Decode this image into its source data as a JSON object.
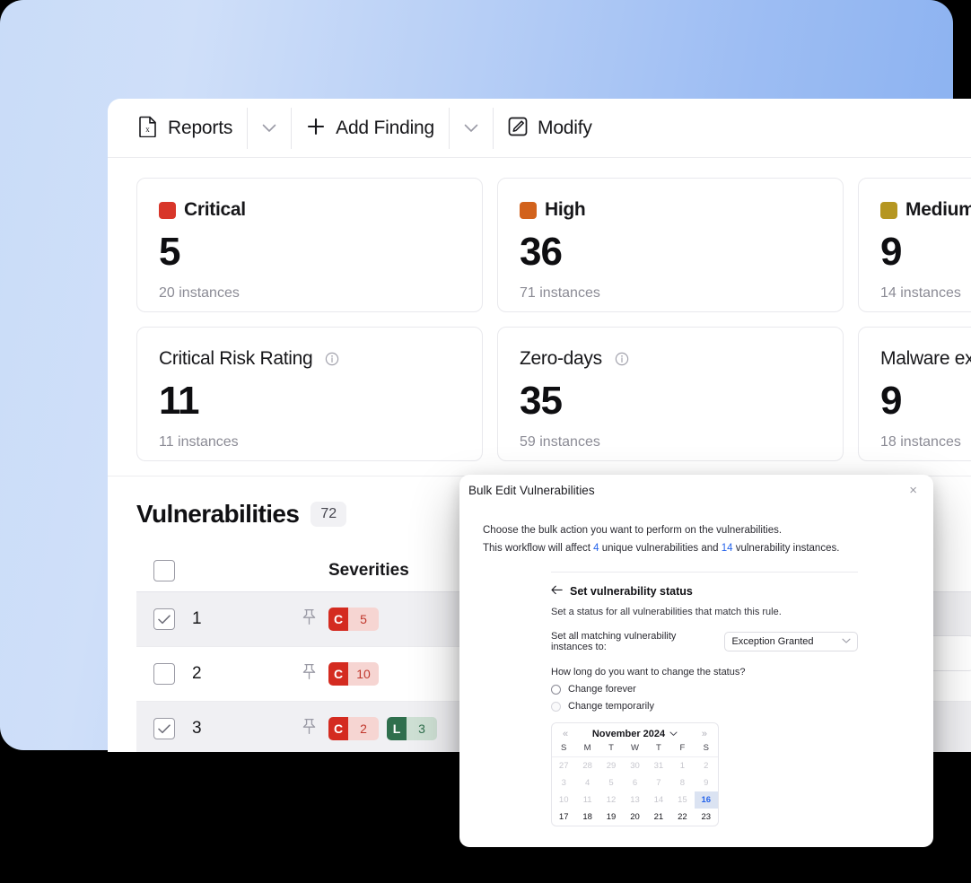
{
  "toolbar": {
    "reports_label": "Reports",
    "add_finding_label": "Add Finding",
    "modify_label": "Modify"
  },
  "stat_cards": [
    {
      "title": "Critical",
      "value": "5",
      "sub": "20 instances",
      "swatch": "#d8362a",
      "has_info": false
    },
    {
      "title": "High",
      "value": "36",
      "sub": "71 instances",
      "swatch": "#d2621c",
      "has_info": false
    },
    {
      "title": "Medium",
      "value": "9",
      "sub": "14 instances",
      "swatch": "#b59621",
      "has_info": false
    },
    {
      "title": "Critical Risk Rating",
      "value": "11",
      "sub": "11 instances",
      "swatch": null,
      "has_info": true
    },
    {
      "title": "Zero-days",
      "value": "35",
      "sub": "59 instances",
      "swatch": null,
      "has_info": true
    },
    {
      "title": "Malware expl",
      "value": "9",
      "sub": "18 instances",
      "swatch": null,
      "has_info": false
    }
  ],
  "vulnerabilities": {
    "title": "Vulnerabilities",
    "count": "72",
    "columns": {
      "severities": "Severities"
    },
    "rows": [
      {
        "num": "1",
        "checked": true,
        "badges": [
          {
            "kind": "crit",
            "key": "C",
            "value": "5"
          }
        ]
      },
      {
        "num": "2",
        "checked": false,
        "badges": [
          {
            "kind": "crit",
            "key": "C",
            "value": "10"
          }
        ]
      },
      {
        "num": "3",
        "checked": true,
        "badges": [
          {
            "kind": "crit",
            "key": "C",
            "value": "2"
          },
          {
            "kind": "low",
            "key": "L",
            "value": "3"
          }
        ]
      }
    ]
  },
  "modal": {
    "title": "Bulk Edit Vulnerabilities",
    "close_label": "×",
    "intro_line": "Choose the bulk action you want to perform on the vulnerabilities.",
    "affect_prefix": "This workflow will affect ",
    "affect_unique_count": "4",
    "affect_middle": " unique vulnerabilities and ",
    "affect_instance_count": "14",
    "affect_suffix": " vulnerability instances.",
    "rule": {
      "title": "Set vulnerability status",
      "subtitle": "Set a status for all vulnerabilities that match this rule.",
      "status_label": "Set all matching vulnerability instances to:",
      "status_value": "Exception Granted",
      "duration_question": "How long do you want to change the status?",
      "radio_forever": "Change forever",
      "radio_temporary": "Change temporarily"
    },
    "calendar": {
      "prev_label": "«",
      "next_label": "»",
      "month_label": "November 2024",
      "dow": [
        "S",
        "M",
        "T",
        "W",
        "T",
        "F",
        "S"
      ],
      "weeks": [
        [
          {
            "d": "27",
            "m": true
          },
          {
            "d": "28",
            "m": true
          },
          {
            "d": "29",
            "m": true
          },
          {
            "d": "30",
            "m": true
          },
          {
            "d": "31",
            "m": true
          },
          {
            "d": "1",
            "m": true
          },
          {
            "d": "2",
            "m": true
          }
        ],
        [
          {
            "d": "3",
            "m": true
          },
          {
            "d": "4",
            "m": true
          },
          {
            "d": "5",
            "m": true
          },
          {
            "d": "6",
            "m": true
          },
          {
            "d": "7",
            "m": true
          },
          {
            "d": "8",
            "m": true
          },
          {
            "d": "9",
            "m": true
          }
        ],
        [
          {
            "d": "10",
            "m": true
          },
          {
            "d": "11",
            "m": true
          },
          {
            "d": "12",
            "m": true
          },
          {
            "d": "13",
            "m": true
          },
          {
            "d": "14",
            "m": true
          },
          {
            "d": "15",
            "m": true
          },
          {
            "d": "16",
            "m": false,
            "today": true
          }
        ],
        [
          {
            "d": "17"
          },
          {
            "d": "18"
          },
          {
            "d": "19"
          },
          {
            "d": "20"
          },
          {
            "d": "21"
          },
          {
            "d": "22"
          },
          {
            "d": "23"
          }
        ]
      ]
    }
  },
  "colors": {
    "critical": "#d8362a",
    "high": "#d2621c",
    "medium": "#b59621",
    "low": "#2f6f4d",
    "accent_blue": "#2563eb",
    "backdrop_from": "#c9dcf8",
    "backdrop_to": "#85aef0"
  }
}
